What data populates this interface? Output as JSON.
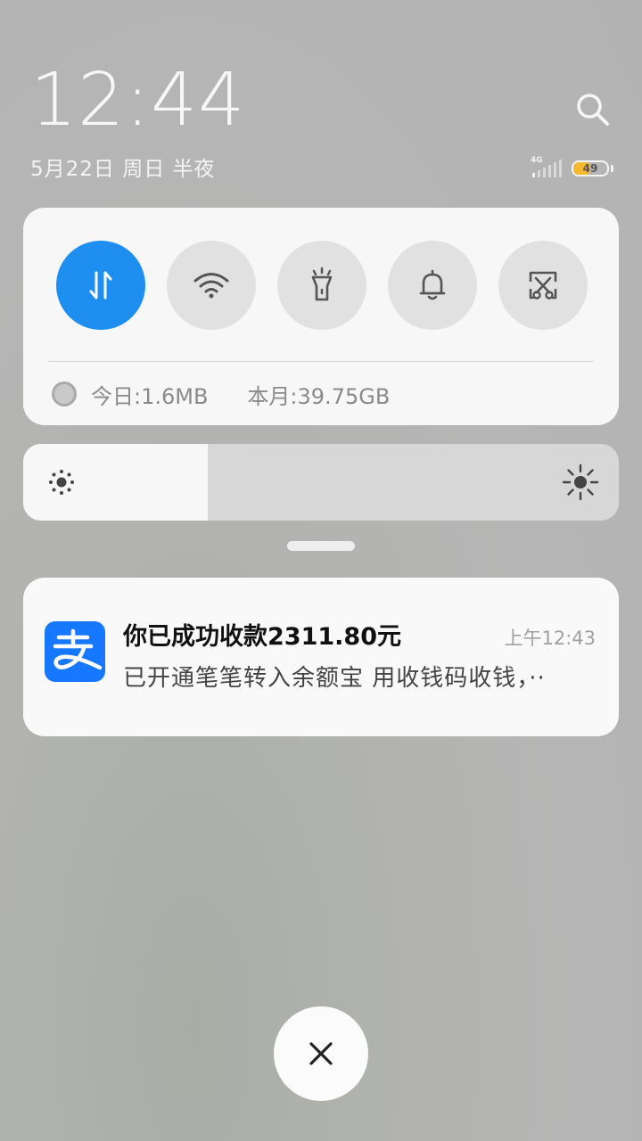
{
  "header": {
    "time": "12:44",
    "date": "5月22日 周日 半夜",
    "network_type": "4G",
    "battery_level": "49",
    "battery_fraction": 0.49
  },
  "quick_settings": {
    "toggles": [
      {
        "icon": "mobile-data-icon",
        "active": true
      },
      {
        "icon": "wifi-icon",
        "active": false
      },
      {
        "icon": "flashlight-icon",
        "active": false
      },
      {
        "icon": "bell-icon",
        "active": false
      },
      {
        "icon": "screenshot-icon",
        "active": false
      }
    ],
    "data_usage": {
      "today": "今日:1.6MB",
      "month": "本月:39.75GB"
    }
  },
  "brightness": {
    "level": 0.31
  },
  "notification": {
    "app_icon": "alipay-icon",
    "app_color": "#1677ff",
    "title": "你已成功收款2311.80元",
    "time": "上午12:43",
    "body": "已开通笔笔转入余额宝 用收钱码收钱，··"
  },
  "colors": {
    "accent": "#1e8ff0"
  }
}
